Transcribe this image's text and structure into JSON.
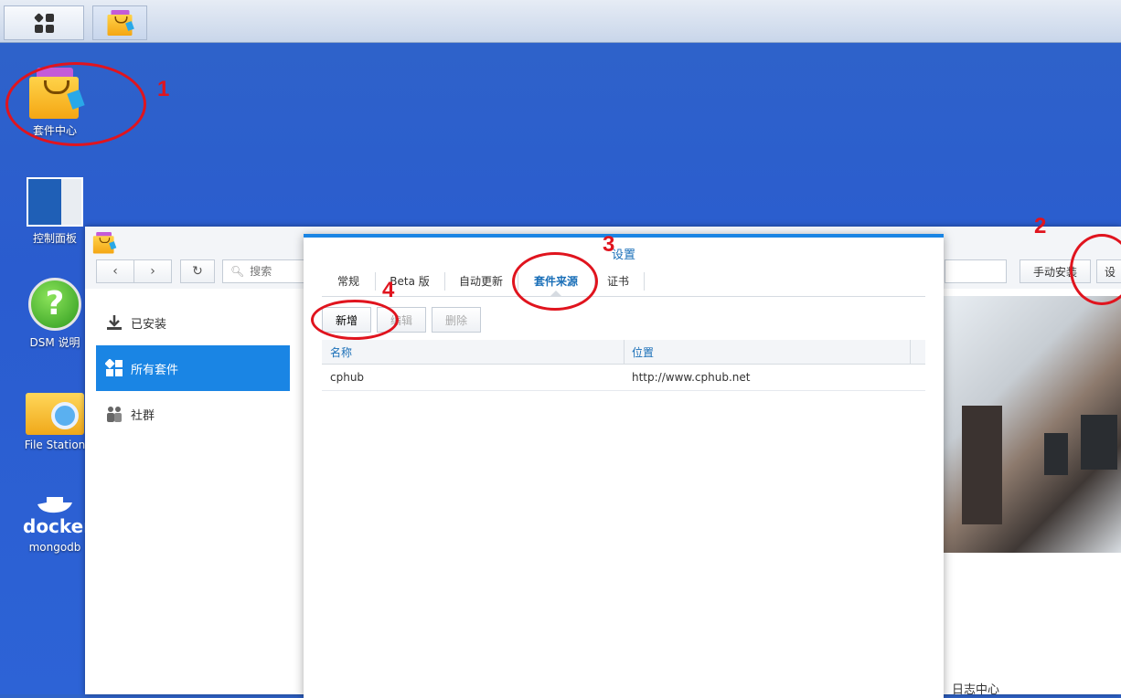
{
  "taskbar": {
    "main_menu_icon": "grid-menu-icon",
    "app_icon": "package-center-icon"
  },
  "desktop": {
    "icons": [
      {
        "label": "套件中心",
        "icon": "package-center-icon"
      },
      {
        "label": "控制面板",
        "icon": "control-panel-icon"
      },
      {
        "label": "DSM 说明",
        "icon": "help-icon"
      },
      {
        "label": "File Station",
        "icon": "file-station-icon"
      },
      {
        "label": "mongodb",
        "icon": "docker-icon",
        "logo_text": "docker"
      }
    ]
  },
  "annotations": {
    "a1": "1",
    "a2": "2",
    "a3": "3",
    "a4": "4",
    "color": "#e0141e"
  },
  "package_center": {
    "search_placeholder": "搜索",
    "manual_install": "手动安装",
    "settings_button": "设",
    "sidebar": [
      {
        "label": "已安装",
        "icon": "download-icon"
      },
      {
        "label": "所有套件",
        "icon": "grid-icon",
        "active": true
      },
      {
        "label": "社群",
        "icon": "community-icon"
      }
    ],
    "log_center": "日志中心",
    "accent": "#1a85e4"
  },
  "settings": {
    "title": "设置",
    "tabs": [
      "常规",
      "Beta 版",
      "自动更新",
      "套件来源",
      "证书"
    ],
    "selected_tab": "套件来源",
    "buttons": {
      "add": "新增",
      "edit": "编辑",
      "delete": "删除"
    },
    "columns": [
      "名称",
      "位置"
    ],
    "rows": [
      {
        "name": "cphub",
        "location": "http://www.cphub.net"
      }
    ]
  }
}
